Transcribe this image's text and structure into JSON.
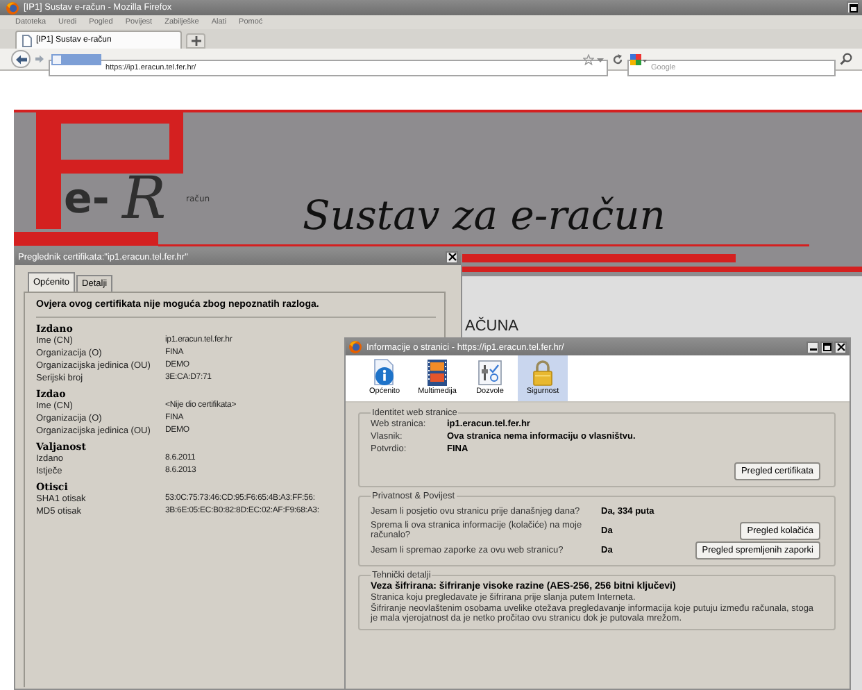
{
  "browser": {
    "title": "[IP1] Sustav e-račun - Mozilla Firefox",
    "menu": [
      "Datoteka",
      "Uredi",
      "Pogled",
      "Povijest",
      "Zabilješke",
      "Alati",
      "Pomoć"
    ],
    "tabs": [
      {
        "label": "[IP1] Sustav e-račun",
        "selected": true
      }
    ],
    "url": "https://ip1.eracun.tel.fer.hr/",
    "search": {
      "placeholder": "Google"
    }
  },
  "page": {
    "logo_letters": "e-",
    "logo_initial": "R",
    "logo_small": "račun",
    "heading": "Sustav za e-račun",
    "partial_heading": "AČUNA"
  },
  "certificate_dialog": {
    "title": "Preglednik certifikata:\"ip1.eracun.tel.fer.hr\"",
    "tabs": [
      {
        "label": "Općenito",
        "selected": true
      },
      {
        "label": "Detalji",
        "selected": false
      }
    ],
    "warning": "Ovjera ovog certifikata nije moguća zbog nepoznatih razloga.",
    "sections": [
      {
        "heading": "Izdano",
        "rows": [
          {
            "label": "Ime (CN)",
            "value": "ip1.eracun.tel.fer.hr"
          },
          {
            "label": "Organizacija (O)",
            "value": "FINA"
          },
          {
            "label": "Organizacijska jedinica (OU)",
            "value": "DEMO"
          },
          {
            "label": "Serijski broj",
            "value": "3E:CA:D7:71"
          }
        ]
      },
      {
        "heading": "Izdao",
        "rows": [
          {
            "label": "Ime (CN)",
            "value": "<Nije dio certifikata>"
          },
          {
            "label": "Organizacija (O)",
            "value": "FINA"
          },
          {
            "label": "Organizacijska jedinica (OU)",
            "value": "DEMO"
          }
        ]
      },
      {
        "heading": "Valjanost",
        "rows": [
          {
            "label": "Izdano",
            "value": "8.6.2011"
          },
          {
            "label": "Istječe",
            "value": "8.6.2013"
          }
        ]
      },
      {
        "heading": "Otisci",
        "rows": [
          {
            "label": "SHA1 otisak",
            "value": "53:0C:75:73:46:CD:95:F6:65:4B:A3:FF:56:"
          },
          {
            "label": "MD5 otisak",
            "value": "3B:6E:05:EC:B0:82:8D:EC:02:AF:F9:68:A3:"
          }
        ]
      }
    ]
  },
  "page_info_dialog": {
    "title": "Informacije o stranici - https://ip1.eracun.tel.fer.hr/",
    "toolbar": [
      {
        "label": "Općenito",
        "kind": "info",
        "selected": false
      },
      {
        "label": "Multimedija",
        "kind": "media",
        "selected": false
      },
      {
        "label": "Dozvole",
        "kind": "permissions",
        "selected": false
      },
      {
        "label": "Sigurnost",
        "kind": "security",
        "selected": true
      }
    ],
    "identity": {
      "legend": "Identitet web stranice",
      "rows": [
        {
          "label": "Web stranica:",
          "value": "ip1.eracun.tel.fer.hr"
        },
        {
          "label": "Vlasnik:",
          "value": "Ova stranica nema informaciju o vlasništvu."
        },
        {
          "label": "Potvrdio:",
          "value": "FINA"
        }
      ],
      "button": "Pregled certifikata"
    },
    "privacy": {
      "legend": "Privatnost & Povijest",
      "rows": [
        {
          "question": "Jesam li posjetio ovu stranicu prije današnjeg dana?",
          "answer": "Da, 334 puta"
        },
        {
          "question": "Sprema li ova stranica informacije (kolačiće) na moje računalo?",
          "answer": "Da",
          "button": "Pregled kolačića"
        },
        {
          "question": "Jesam li spremao zaporke za ovu web stranicu?",
          "answer": "Da",
          "button": "Pregled spremljenih zaporki"
        }
      ]
    },
    "technical": {
      "legend": "Tehnički detalji",
      "headline": "Veza šifrirana: šifriranje visoke razine (AES-256, 256 bitni ključevi)",
      "paragraphs": [
        "Stranica koju pregledavate je šifrirana prije slanja putem Interneta.",
        "Šifriranje neovlaštenim osobama uvelike otežava pregledavanje informacija koje putuju između računala, stoga je mala vjerojatnost da je netko pročitao ovu stranicu dok je putovala mrežom."
      ]
    }
  }
}
